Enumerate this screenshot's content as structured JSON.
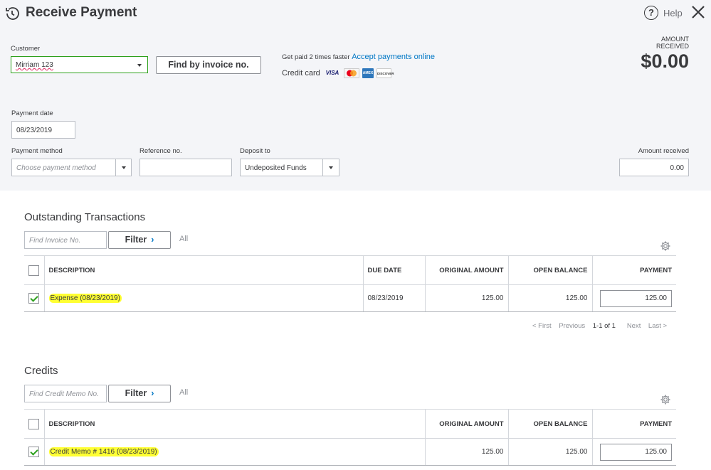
{
  "header": {
    "title": "Receive Payment",
    "help_label": "Help"
  },
  "customer": {
    "label": "Customer",
    "value": "Mirriam 123",
    "find_invoice_label": "Find by invoice no."
  },
  "promo": {
    "getpaid_text": "Get paid 2 times faster",
    "accept_link": "Accept payments online",
    "credit_card_label": "Credit card",
    "cards": [
      "VISA",
      "MC",
      "AMEX",
      "DISCOVER"
    ]
  },
  "amount_received_header": {
    "label_line1": "AMOUNT",
    "label_line2": "RECEIVED",
    "value": "$0.00"
  },
  "payment_date": {
    "label": "Payment date",
    "value": "08/23/2019"
  },
  "payment_method": {
    "label": "Payment method",
    "placeholder": "Choose payment method"
  },
  "reference": {
    "label": "Reference no.",
    "value": ""
  },
  "deposit_to": {
    "label": "Deposit to",
    "value": "Undeposited Funds"
  },
  "amount_received_field": {
    "label": "Amount received",
    "value": "0.00"
  },
  "outstanding": {
    "title": "Outstanding Transactions",
    "search_placeholder": "Find Invoice No.",
    "filter_label": "Filter",
    "all_label": "All",
    "columns": {
      "description": "DESCRIPTION",
      "due_date": "DUE DATE",
      "original_amount": "ORIGINAL AMOUNT",
      "open_balance": "OPEN BALANCE",
      "payment": "PAYMENT"
    },
    "rows": [
      {
        "checked": true,
        "description": "Expense (08/23/2019)",
        "due_date": "08/23/2019",
        "original_amount": "125.00",
        "open_balance": "125.00",
        "payment": "125.00"
      }
    ],
    "pager": {
      "first": "< First",
      "previous": "Previous",
      "range": "1-1 of 1",
      "next": "Next",
      "last": "Last >"
    }
  },
  "credits": {
    "title": "Credits",
    "search_placeholder": "Find Credit Memo No.",
    "filter_label": "Filter",
    "all_label": "All",
    "columns": {
      "description": "DESCRIPTION",
      "original_amount": "ORIGINAL AMOUNT",
      "open_balance": "OPEN BALANCE",
      "payment": "PAYMENT"
    },
    "rows": [
      {
        "checked": true,
        "description": "Credit Memo # 1416 (08/23/2019)",
        "original_amount": "125.00",
        "open_balance": "125.00",
        "payment": "125.00"
      }
    ]
  },
  "colors": {
    "accent_green": "#2ca01c",
    "link_blue": "#0077c5",
    "highlight_yellow": "#ffff33",
    "panel_bg": "#f4f5f8"
  }
}
